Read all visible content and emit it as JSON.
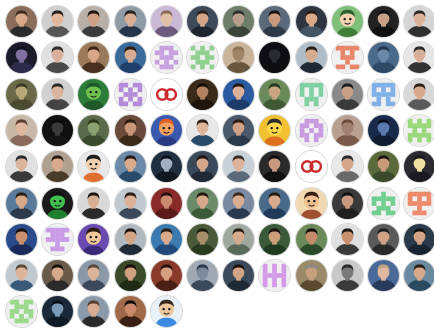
{
  "grid": {
    "columns": 12,
    "avatars": [
      {
        "kind": "photo",
        "bg": "#8a6d5b",
        "skin": "#d9a98a",
        "shirt": "#2b2b2b",
        "hair": "#3a2a20"
      },
      {
        "kind": "photo",
        "bg": "#cfcfcf",
        "skin": "#e2b79a",
        "shirt": "#555555",
        "hair": "#2a1f18"
      },
      {
        "kind": "photo",
        "bg": "#b8b0a8",
        "skin": "#cf9f86",
        "shirt": "#3b3b3b",
        "hair": "#1e1612"
      },
      {
        "kind": "photo",
        "bg": "#8e9aa6",
        "skin": "#d7ad93",
        "shirt": "#24344a",
        "hair": "#2a221c"
      },
      {
        "kind": "photo",
        "bg": "#c9b9d6",
        "skin": "#e2c0a8",
        "shirt": "#6b5a7e",
        "hair": "#8a6a55"
      },
      {
        "kind": "photo",
        "bg": "#3d4a5a",
        "skin": "#d2a488",
        "shirt": "#1d2630",
        "hair": "#2b201a"
      },
      {
        "kind": "photo",
        "bg": "#6f7e6a",
        "skin": "#b9a08e",
        "shirt": "#3a4437",
        "hair": "#303030"
      },
      {
        "kind": "photo",
        "bg": "#5b6a7a",
        "skin": "#c99a7b",
        "shirt": "#2d3a48",
        "hair": "#1b1410"
      },
      {
        "kind": "photo",
        "bg": "#2e3540",
        "skin": "#d8a98b",
        "shirt": "#445566",
        "hair": "#2a1c14"
      },
      {
        "kind": "cartoon",
        "bg": "#7ec07a",
        "skin": "#f2d2b0",
        "shirt": "#3f7f3a",
        "hair": "#2f5f2a"
      },
      {
        "kind": "photo",
        "bg": "#222222",
        "skin": "#c8a088",
        "shirt": "#111111",
        "hair": "#0f0f0f"
      },
      {
        "kind": "photo",
        "bg": "#d5d5d5",
        "skin": "#dcb39a",
        "shirt": "#303030",
        "hair": "#2a2a2a"
      },
      {
        "kind": "photo",
        "bg": "#1a1a2a",
        "skin": "#7f6f9f",
        "shirt": "#2c2c4a",
        "hair": "#111122"
      },
      {
        "kind": "photo",
        "bg": "#e0e0e0",
        "skin": "#d9b09a",
        "shirt": "#4a4a4a",
        "hair": "#2b2b2b"
      },
      {
        "kind": "photo",
        "bg": "#9a7a5a",
        "skin": "#d6a686",
        "shirt": "#4a3020",
        "hair": "#3a2516"
      },
      {
        "kind": "photo",
        "bg": "#3a6a9a",
        "skin": "#d7ab8f",
        "shirt": "#1f3f6a",
        "hair": "#2a1d14"
      },
      {
        "kind": "identicon",
        "color": "#c8a0e0",
        "cells": [
          0,
          1,
          1,
          1,
          0,
          1,
          1,
          0,
          1,
          1,
          0,
          1,
          1,
          1,
          0,
          1,
          0,
          1,
          0,
          1,
          0,
          1,
          1,
          1,
          0
        ]
      },
      {
        "kind": "identicon",
        "color": "#8fd08f",
        "cells": [
          1,
          0,
          1,
          0,
          1,
          0,
          1,
          1,
          1,
          0,
          1,
          1,
          0,
          1,
          1,
          0,
          1,
          1,
          1,
          0,
          1,
          0,
          1,
          0,
          1
        ]
      },
      {
        "kind": "photo",
        "bg": "#c9b49a",
        "skin": "#a08668",
        "shirt": "#6a563f",
        "hair": "#8a7356"
      },
      {
        "kind": "photo",
        "bg": "#0d0d12",
        "skin": "#2a2a33",
        "shirt": "#0d0d12",
        "hair": "#0d0d12"
      },
      {
        "kind": "photo",
        "bg": "#b0bcc8",
        "skin": "#d6ac90",
        "shirt": "#1f2a36",
        "hair": "#2b2019"
      },
      {
        "kind": "identicon",
        "color": "#e8846a",
        "cells": [
          1,
          1,
          1,
          1,
          1,
          0,
          1,
          0,
          1,
          0,
          0,
          1,
          1,
          1,
          0,
          0,
          0,
          1,
          0,
          0,
          1,
          1,
          0,
          1,
          1
        ]
      },
      {
        "kind": "photo",
        "bg": "#4a6a8a",
        "skin": "#6a8aa8",
        "shirt": "#2f4a66",
        "hair": "#20364c"
      },
      {
        "kind": "photo",
        "bg": "#e6e6e6",
        "skin": "#d8b099",
        "shirt": "#333333",
        "hair": "#2a2a2a"
      },
      {
        "kind": "photo",
        "bg": "#6a6a4a",
        "skin": "#b8a878",
        "shirt": "#4a4a30",
        "hair": "#3a3a24"
      },
      {
        "kind": "photo",
        "bg": "#d0d0d0",
        "skin": "#dab49c",
        "shirt": "#444444",
        "hair": "#2b2b2b"
      },
      {
        "kind": "cartoon",
        "bg": "#2d7d3a",
        "skin": "#6fc04f",
        "shirt": "#1f5a28",
        "hair": "#1f5a28"
      },
      {
        "kind": "identicon",
        "color": "#b58ad8",
        "cells": [
          1,
          1,
          0,
          1,
          1,
          1,
          0,
          1,
          0,
          1,
          0,
          1,
          1,
          1,
          0,
          1,
          0,
          1,
          0,
          1,
          1,
          1,
          0,
          1,
          1
        ]
      },
      {
        "kind": "logo",
        "bg": "#ffffff",
        "fg": "#d0262e"
      },
      {
        "kind": "photo",
        "bg": "#3a2a1a",
        "skin": "#b3835f",
        "shirt": "#1f150c",
        "hair": "#140d08"
      },
      {
        "kind": "photo",
        "bg": "#2a5aa0",
        "skin": "#dcb09a",
        "shirt": "#1c3a6a",
        "hair": "#231810"
      },
      {
        "kind": "photo",
        "bg": "#6a8a5a",
        "skin": "#c9a382",
        "shirt": "#405a35",
        "hair": "#2a3a22"
      },
      {
        "kind": "identicon",
        "color": "#7fd0a0",
        "cells": [
          1,
          1,
          1,
          1,
          1,
          1,
          0,
          1,
          0,
          1,
          1,
          0,
          1,
          0,
          1,
          0,
          1,
          1,
          1,
          0,
          0,
          1,
          0,
          1,
          0
        ]
      },
      {
        "kind": "photo",
        "bg": "#8a8a8a",
        "skin": "#c8a088",
        "shirt": "#3a3a3a",
        "hair": "#1e1e1e"
      },
      {
        "kind": "identicon",
        "color": "#7fb0e8",
        "cells": [
          1,
          1,
          1,
          1,
          1,
          1,
          0,
          1,
          0,
          1,
          1,
          1,
          1,
          1,
          1,
          0,
          1,
          0,
          1,
          0,
          1,
          1,
          0,
          1,
          1
        ]
      },
      {
        "kind": "photo",
        "bg": "#d8d8d8",
        "skin": "#d6a88c",
        "shirt": "#5a5a5a",
        "hair": "#2a1f18"
      },
      {
        "kind": "photo",
        "bg": "#c8b8a8",
        "skin": "#e0b8a0",
        "shirt": "#8a6a5a",
        "hair": "#5a3f2f"
      },
      {
        "kind": "photo",
        "bg": "#101010",
        "skin": "#3a3a3a",
        "shirt": "#151515",
        "hair": "#0a0a0a"
      },
      {
        "kind": "photo",
        "bg": "#5a6a4a",
        "skin": "#8aa070",
        "shirt": "#3a4a2a",
        "hair": "#2a3a1a"
      },
      {
        "kind": "photo",
        "bg": "#6a4a3a",
        "skin": "#c99679",
        "shirt": "#3a2a1a",
        "hair": "#2a1a10"
      },
      {
        "kind": "cartoon",
        "bg": "#3a5ab0",
        "skin": "#f0a060",
        "shirt": "#2a3a80",
        "hair": "#e06020"
      },
      {
        "kind": "photo",
        "bg": "#e8e8e8",
        "skin": "#dcb49a",
        "shirt": "#2a4a6a",
        "hair": "#2a1f18"
      },
      {
        "kind": "photo",
        "bg": "#4a5a6a",
        "skin": "#d0a287",
        "shirt": "#2a3a4a",
        "hair": "#2a1d14"
      },
      {
        "kind": "cartoon",
        "bg": "#f0c030",
        "skin": "#ffd84a",
        "shirt": "#e07020",
        "hair": "#2a2a2a"
      },
      {
        "kind": "identicon",
        "color": "#c89ae0",
        "cells": [
          0,
          1,
          1,
          1,
          0,
          1,
          1,
          0,
          1,
          1,
          1,
          0,
          1,
          0,
          1,
          1,
          1,
          0,
          1,
          1,
          0,
          1,
          0,
          1,
          0
        ]
      },
      {
        "kind": "photo",
        "bg": "#b8a090",
        "skin": "#a08070",
        "shirt": "#7a5a4a",
        "hair": "#6a4a3a"
      },
      {
        "kind": "photo",
        "bg": "#1a2a4a",
        "skin": "#5a7ab0",
        "shirt": "#101a30",
        "hair": "#0a1020"
      },
      {
        "kind": "identicon",
        "color": "#9ad87a",
        "cells": [
          1,
          0,
          1,
          0,
          1,
          1,
          1,
          1,
          1,
          1,
          0,
          1,
          0,
          1,
          0,
          1,
          1,
          1,
          1,
          1,
          1,
          0,
          1,
          0,
          1
        ]
      },
      {
        "kind": "photo",
        "bg": "#e0e0e0",
        "skin": "#dcb49c",
        "shirt": "#3a3a3a",
        "hair": "#2a2a2a"
      },
      {
        "kind": "photo",
        "bg": "#b0a090",
        "skin": "#d7aa8c",
        "shirt": "#4a3a2a",
        "hair": "#2a1d14"
      },
      {
        "kind": "cartoon",
        "bg": "#e8e8e8",
        "skin": "#f0d0b0",
        "shirt": "#e07030",
        "hair": "#1a1a1a"
      },
      {
        "kind": "photo",
        "bg": "#6a8aa8",
        "skin": "#d9ab8c",
        "shirt": "#2a4a6a",
        "hair": "#241812"
      },
      {
        "kind": "photo",
        "bg": "#203040",
        "skin": "#a0b0c0",
        "shirt": "#101820",
        "hair": "#0a1018"
      },
      {
        "kind": "photo",
        "bg": "#3a4a5a",
        "skin": "#d6a68a",
        "shirt": "#1f2a36",
        "hair": "#211711"
      },
      {
        "kind": "photo",
        "bg": "#c8d0d8",
        "skin": "#ddb49a",
        "shirt": "#5a6a7a",
        "hair": "#3a2a20"
      },
      {
        "kind": "photo",
        "bg": "#2a2a2a",
        "skin": "#c99a7e",
        "shirt": "#111111",
        "hair": "#0f0f0f"
      },
      {
        "kind": "logo",
        "bg": "#ffffff",
        "fg": "#c82a2a"
      },
      {
        "kind": "photo",
        "bg": "#e8e8e8",
        "skin": "#d2a48a",
        "shirt": "#6a6a6a",
        "hair": "#2a2a2a"
      },
      {
        "kind": "photo",
        "bg": "#5a6a3a",
        "skin": "#c99a7a",
        "shirt": "#3a4a2a",
        "hair": "#221810"
      },
      {
        "kind": "photo",
        "bg": "#2a2a30",
        "skin": "#f0e0a0",
        "shirt": "#1a1a20",
        "hair": "#1a1a20"
      },
      {
        "kind": "photo",
        "bg": "#5a7a9a",
        "skin": "#d6a88a",
        "shirt": "#2a3a4a",
        "hair": "#2b2019"
      },
      {
        "kind": "cartoon",
        "bg": "#1a1a1a",
        "skin": "#40c050",
        "shirt": "#208030",
        "hair": "#101010"
      },
      {
        "kind": "photo",
        "bg": "#d8d8d8",
        "skin": "#d8ae92",
        "shirt": "#2a2a2a",
        "hair": "#1e1612"
      },
      {
        "kind": "photo",
        "bg": "#c0c8d0",
        "skin": "#dbb096",
        "shirt": "#3a4a5a",
        "hair": "#2a1f18"
      },
      {
        "kind": "photo",
        "bg": "#8a2a2a",
        "skin": "#c98a70",
        "shirt": "#5a1a1a",
        "hair": "#2a1010"
      },
      {
        "kind": "photo",
        "bg": "#6a8a6a",
        "skin": "#d5a88a",
        "shirt": "#3a5a3a",
        "hair": "#22180f"
      },
      {
        "kind": "photo",
        "bg": "#7a8aa0",
        "skin": "#d9ae92",
        "shirt": "#2a3a50",
        "hair": "#3a2a1f"
      },
      {
        "kind": "photo",
        "bg": "#4a6a8a",
        "skin": "#d8aa8e",
        "shirt": "#203a5a",
        "hair": "#241a12"
      },
      {
        "kind": "cartoon",
        "bg": "#f0d8b0",
        "skin": "#f0c090",
        "shirt": "#a05030",
        "hair": "#3a2010"
      },
      {
        "kind": "photo",
        "bg": "#3a3a3a",
        "skin": "#c99a7e",
        "shirt": "#1f1f1f",
        "hair": "#121212"
      },
      {
        "kind": "identicon",
        "color": "#6fcf8f",
        "cells": [
          0,
          0,
          1,
          0,
          0,
          1,
          1,
          1,
          1,
          1,
          1,
          0,
          1,
          0,
          1,
          0,
          1,
          1,
          1,
          0,
          1,
          1,
          0,
          1,
          1
        ]
      },
      {
        "kind": "identicon",
        "color": "#ec8a6a",
        "cells": [
          1,
          1,
          1,
          1,
          1,
          1,
          0,
          1,
          0,
          1,
          1,
          1,
          1,
          1,
          1,
          0,
          0,
          1,
          0,
          0,
          0,
          1,
          1,
          1,
          0
        ]
      },
      {
        "kind": "photo",
        "bg": "#2a4a8a",
        "skin": "#c8906f",
        "shirt": "#1a2a5a",
        "hair": "#1a120c"
      },
      {
        "kind": "identicon",
        "color": "#c89ae8",
        "cells": [
          1,
          1,
          1,
          1,
          1,
          0,
          1,
          1,
          1,
          0,
          1,
          1,
          1,
          1,
          1,
          0,
          0,
          1,
          0,
          0,
          0,
          1,
          1,
          1,
          0
        ]
      },
      {
        "kind": "cartoon",
        "bg": "#6a4ab0",
        "skin": "#f0c89a",
        "shirt": "#3a2a7a",
        "hair": "#2a1a10"
      },
      {
        "kind": "photo",
        "bg": "#b0b8c0",
        "skin": "#d4a486",
        "shirt": "#1f2a36",
        "hair": "#1a120c"
      },
      {
        "kind": "photo",
        "bg": "#3a7ab0",
        "skin": "#d7aa8c",
        "shirt": "#1f4a7a",
        "hair": "#2a1d14"
      },
      {
        "kind": "photo",
        "bg": "#4a5a3a",
        "skin": "#a8906a",
        "shirt": "#2a3a1f",
        "hair": "#1a2012"
      },
      {
        "kind": "photo",
        "bg": "#a0a8a0",
        "skin": "#d6aa8c",
        "shirt": "#5a6a5a",
        "hair": "#2b2019"
      },
      {
        "kind": "photo",
        "bg": "#3a5a3a",
        "skin": "#c9a07a",
        "shirt": "#1f3a1f",
        "hair": "#1a120c"
      },
      {
        "kind": "photo",
        "bg": "#6a8a5a",
        "skin": "#c48a6a",
        "shirt": "#2a4a2a",
        "hair": "#120c08"
      },
      {
        "kind": "photo",
        "bg": "#e0e0e0",
        "skin": "#c89070",
        "shirt": "#3a3a3a",
        "hair": "#1a1a1a"
      },
      {
        "kind": "photo",
        "bg": "#5a5a5a",
        "skin": "#d0a286",
        "shirt": "#2a2a2a",
        "hair": "#1f1f1f"
      },
      {
        "kind": "photo",
        "bg": "#2a3a4a",
        "skin": "#d4a488",
        "shirt": "#1a2430",
        "hair": "#111111"
      },
      {
        "kind": "photo",
        "bg": "#c0c8d0",
        "skin": "#dcb49a",
        "shirt": "#3a5a7a",
        "hair": "#5a4a3a"
      },
      {
        "kind": "photo",
        "bg": "#6a5a4a",
        "skin": "#d6a88c",
        "shirt": "#2a2a2a",
        "hair": "#1a120c"
      },
      {
        "kind": "photo",
        "bg": "#8a98a8",
        "skin": "#dcb49a",
        "shirt": "#3a4a5a",
        "hair": "#5a4a3a"
      },
      {
        "kind": "photo",
        "bg": "#3a4a2a",
        "skin": "#d0a080",
        "shirt": "#1f2a14",
        "hair": "#1a120c"
      },
      {
        "kind": "photo",
        "bg": "#8a3a2a",
        "skin": "#d4a080",
        "shirt": "#4a1f14",
        "hair": "#2a120c"
      },
      {
        "kind": "photo",
        "bg": "#a0aab4",
        "skin": "#7a8a9a",
        "shirt": "#3a4a5a",
        "hair": "#2a3a4a"
      },
      {
        "kind": "photo",
        "bg": "#3a4a5a",
        "skin": "#d2a487",
        "shirt": "#1f2a36",
        "hair": "#1a120c"
      },
      {
        "kind": "identicon",
        "color": "#d49ae8",
        "cells": [
          1,
          0,
          1,
          0,
          1,
          1,
          0,
          1,
          0,
          1,
          1,
          1,
          1,
          1,
          1,
          1,
          0,
          1,
          0,
          1,
          1,
          0,
          1,
          0,
          1
        ]
      },
      {
        "kind": "photo",
        "bg": "#9a8a6a",
        "skin": "#c9a07e",
        "shirt": "#5a4a30",
        "hair": "#8a8a8a"
      },
      {
        "kind": "photo",
        "bg": "#c8c8c8",
        "skin": "#7a7a7a",
        "shirt": "#3a3a3a",
        "hair": "#2a2a2a"
      },
      {
        "kind": "photo",
        "bg": "#4a6a9a",
        "skin": "#e0b8a0",
        "shirt": "#2a3a5a",
        "hair": "#c0a080"
      },
      {
        "kind": "photo",
        "bg": "#6a8aa0",
        "skin": "#d6a88c",
        "shirt": "#2a4a60",
        "hair": "#2b2019"
      },
      {
        "kind": "identicon",
        "color": "#9ad88a",
        "cells": [
          1,
          1,
          0,
          1,
          1,
          0,
          1,
          1,
          1,
          0,
          1,
          1,
          0,
          1,
          1,
          1,
          0,
          1,
          0,
          1,
          0,
          1,
          1,
          1,
          0
        ]
      },
      {
        "kind": "photo",
        "bg": "#1a2a3a",
        "skin": "#7a9ab8",
        "shirt": "#0f1a24",
        "hair": "#0a1018"
      },
      {
        "kind": "photo",
        "bg": "#8a9aaa",
        "skin": "#d8ac92",
        "shirt": "#2a2a2a",
        "hair": "#5a4030"
      },
      {
        "kind": "photo",
        "bg": "#a06a4a",
        "skin": "#c88a6a",
        "shirt": "#3a1f14",
        "hair": "#140c08"
      },
      {
        "kind": "cartoon",
        "bg": "#e8f0f8",
        "skin": "#f0c8a0",
        "shirt": "#3a8ae0",
        "hair": "#3a2a1a"
      }
    ]
  }
}
